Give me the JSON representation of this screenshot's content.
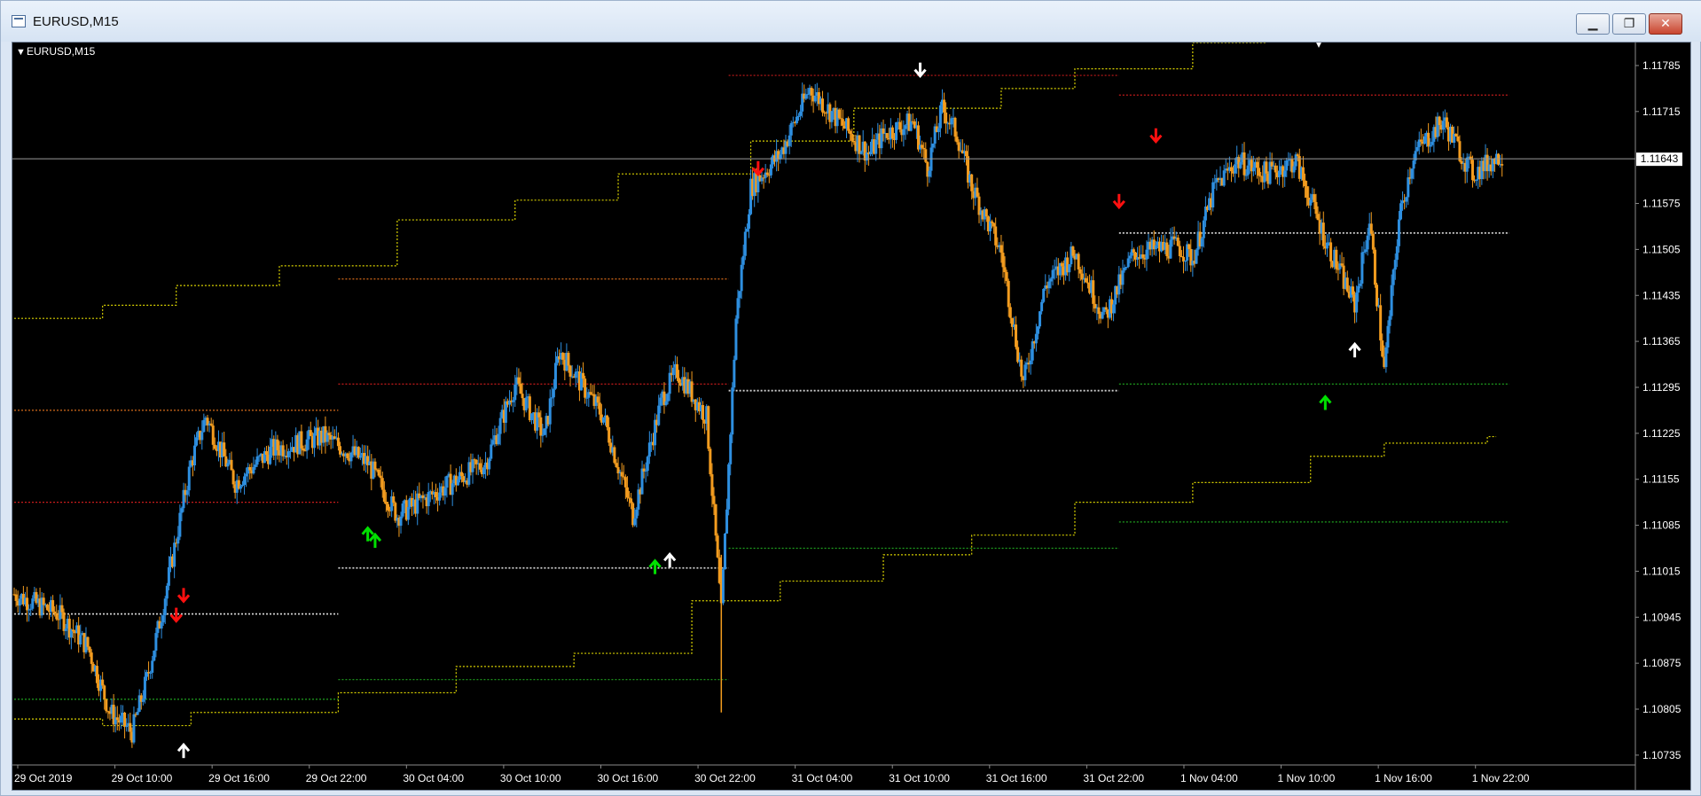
{
  "window": {
    "title": "EURUSD,M15",
    "minimize_icon": "minimize-icon",
    "maximize_icon": "restore-icon",
    "close_icon": "close-icon"
  },
  "chart_label": "EURUSD,M15",
  "colors": {
    "background": "#000000",
    "bull": "#2e8fe0",
    "bear": "#f39c1f",
    "level_yellow": "#d7d000",
    "level_orange": "#d46a1a",
    "level_red": "#c81c1c",
    "level_green": "#1fa21f",
    "level_white": "#cfcfcf",
    "arrow_red": "#ff1010",
    "arrow_green": "#00e000",
    "arrow_white": "#ffffff"
  },
  "chart_data": {
    "type": "candlestick",
    "symbol": "EURUSD",
    "timeframe": "M15",
    "current_price": "1.11643",
    "y_ticks": [
      "1.11785",
      "1.11715",
      "1.11575",
      "1.11505",
      "1.11435",
      "1.11365",
      "1.11295",
      "1.11225",
      "1.11155",
      "1.11085",
      "1.11015",
      "1.10945",
      "1.10875",
      "1.10805",
      "1.10735"
    ],
    "x_ticks": [
      "29 Oct 2019",
      "29 Oct 10:00",
      "29 Oct 16:00",
      "29 Oct 22:00",
      "30 Oct 04:00",
      "30 Oct 10:00",
      "30 Oct 16:00",
      "30 Oct 22:00",
      "31 Oct 04:00",
      "31 Oct 10:00",
      "31 Oct 16:00",
      "31 Oct 22:00",
      "1 Nov 04:00",
      "1 Nov 10:00",
      "1 Nov 16:00",
      "1 Nov 22:00"
    ],
    "ylim": [
      1.1072,
      1.1182
    ],
    "price_path": [
      [
        0,
        1.1098
      ],
      [
        6,
        1.1095
      ],
      [
        10,
        1.109
      ],
      [
        13,
        1.108
      ],
      [
        16,
        1.1077
      ],
      [
        18,
        1.1085
      ],
      [
        20,
        1.1095
      ],
      [
        24,
        1.1118
      ],
      [
        26,
        1.1125
      ],
      [
        30,
        1.1115
      ],
      [
        35,
        1.112
      ],
      [
        42,
        1.1122
      ],
      [
        48,
        1.1118
      ],
      [
        52,
        1.111
      ],
      [
        58,
        1.1114
      ],
      [
        64,
        1.1118
      ],
      [
        68,
        1.113
      ],
      [
        72,
        1.1122
      ],
      [
        74,
        1.1135
      ],
      [
        80,
        1.1125
      ],
      [
        84,
        1.111
      ],
      [
        88,
        1.1128
      ],
      [
        90,
        1.1132
      ],
      [
        94,
        1.1125
      ],
      [
        96,
        1.1095
      ],
      [
        98,
        1.114
      ],
      [
        100,
        1.116
      ],
      [
        104,
        1.1165
      ],
      [
        108,
        1.1175
      ],
      [
        112,
        1.117
      ],
      [
        116,
        1.1165
      ],
      [
        118,
        1.1168
      ],
      [
        122,
        1.117
      ],
      [
        124,
        1.1163
      ],
      [
        126,
        1.1172
      ],
      [
        128,
        1.1168
      ],
      [
        130,
        1.116
      ],
      [
        134,
        1.115
      ],
      [
        137,
        1.113
      ],
      [
        140,
        1.1145
      ],
      [
        144,
        1.115
      ],
      [
        148,
        1.114
      ],
      [
        152,
        1.115
      ],
      [
        158,
        1.1151
      ],
      [
        160,
        1.1149
      ],
      [
        163,
        1.116
      ],
      [
        166,
        1.1164
      ],
      [
        170,
        1.1162
      ],
      [
        174,
        1.1164
      ],
      [
        178,
        1.1152
      ],
      [
        182,
        1.1142
      ],
      [
        184,
        1.1155
      ],
      [
        186,
        1.1132
      ],
      [
        188,
        1.1155
      ],
      [
        190,
        1.1165
      ],
      [
        194,
        1.117
      ],
      [
        198,
        1.1162
      ],
      [
        202,
        1.1165
      ]
    ],
    "levels": [
      {
        "color": "yellow",
        "steps": [
          [
            0,
            1.114
          ],
          [
            12,
            1.1142
          ],
          [
            22,
            1.1145
          ],
          [
            36,
            1.1148
          ],
          [
            52,
            1.1155
          ],
          [
            68,
            1.1158
          ],
          [
            82,
            1.1162
          ],
          [
            100,
            1.1167
          ],
          [
            114,
            1.1172
          ],
          [
            134,
            1.1175
          ],
          [
            144,
            1.1178
          ],
          [
            160,
            1.1182
          ],
          [
            170,
            1.1183
          ]
        ]
      },
      {
        "color": "yellow",
        "steps": [
          [
            0,
            1.1079
          ],
          [
            12,
            1.1078
          ],
          [
            24,
            1.108
          ],
          [
            44,
            1.1083
          ],
          [
            60,
            1.1087
          ],
          [
            76,
            1.1089
          ],
          [
            92,
            1.1097
          ],
          [
            104,
            1.11
          ],
          [
            118,
            1.1104
          ],
          [
            130,
            1.1107
          ],
          [
            144,
            1.1112
          ],
          [
            160,
            1.1115
          ],
          [
            176,
            1.1119
          ],
          [
            186,
            1.1121
          ],
          [
            200,
            1.1122
          ]
        ]
      },
      {
        "color": "orange",
        "x": [
          0,
          44
        ],
        "y": 1.1126
      },
      {
        "color": "orange",
        "x": [
          44,
          97
        ],
        "y": 1.1146
      },
      {
        "color": "red",
        "x": [
          0,
          44
        ],
        "y": 1.1112
      },
      {
        "color": "red",
        "x": [
          44,
          97
        ],
        "y": 1.113
      },
      {
        "color": "red",
        "x": [
          97,
          150
        ],
        "y": 1.1177
      },
      {
        "color": "red",
        "x": [
          150,
          203
        ],
        "y": 1.1174
      },
      {
        "color": "white",
        "x": [
          0,
          44
        ],
        "y": 1.1095
      },
      {
        "color": "white",
        "x": [
          44,
          97
        ],
        "y": 1.1102
      },
      {
        "color": "white",
        "x": [
          97,
          150
        ],
        "y": 1.1129
      },
      {
        "color": "white",
        "x": [
          150,
          203
        ],
        "y": 1.1153
      },
      {
        "color": "green",
        "x": [
          0,
          44
        ],
        "y": 1.1082
      },
      {
        "color": "green",
        "x": [
          44,
          97
        ],
        "y": 1.1085
      },
      {
        "color": "green",
        "x": [
          97,
          150
        ],
        "y": 1.1105
      },
      {
        "color": "green",
        "x": [
          150,
          203
        ],
        "y": 1.1109
      },
      {
        "color": "green",
        "x": [
          150,
          203
        ],
        "y": 1.113
      }
    ],
    "arrows": [
      {
        "x": 23,
        "y": 1.1098,
        "dir": "down",
        "color": "red"
      },
      {
        "x": 22,
        "y": 1.1095,
        "dir": "down",
        "color": "red"
      },
      {
        "x": 23,
        "y": 1.1074,
        "dir": "up",
        "color": "white"
      },
      {
        "x": 48,
        "y": 1.1107,
        "dir": "up",
        "color": "green"
      },
      {
        "x": 49,
        "y": 1.1106,
        "dir": "up",
        "color": "green"
      },
      {
        "x": 87,
        "y": 1.1102,
        "dir": "up",
        "color": "green"
      },
      {
        "x": 89,
        "y": 1.1103,
        "dir": "up",
        "color": "white"
      },
      {
        "x": 101,
        "y": 1.1163,
        "dir": "down",
        "color": "red"
      },
      {
        "x": 123,
        "y": 1.1178,
        "dir": "down",
        "color": "white"
      },
      {
        "x": 150,
        "y": 1.1158,
        "dir": "down",
        "color": "red"
      },
      {
        "x": 155,
        "y": 1.1168,
        "dir": "down",
        "color": "red"
      },
      {
        "x": 178,
        "y": 1.1127,
        "dir": "up",
        "color": "green"
      },
      {
        "x": 182,
        "y": 1.1135,
        "dir": "up",
        "color": "white"
      }
    ]
  }
}
